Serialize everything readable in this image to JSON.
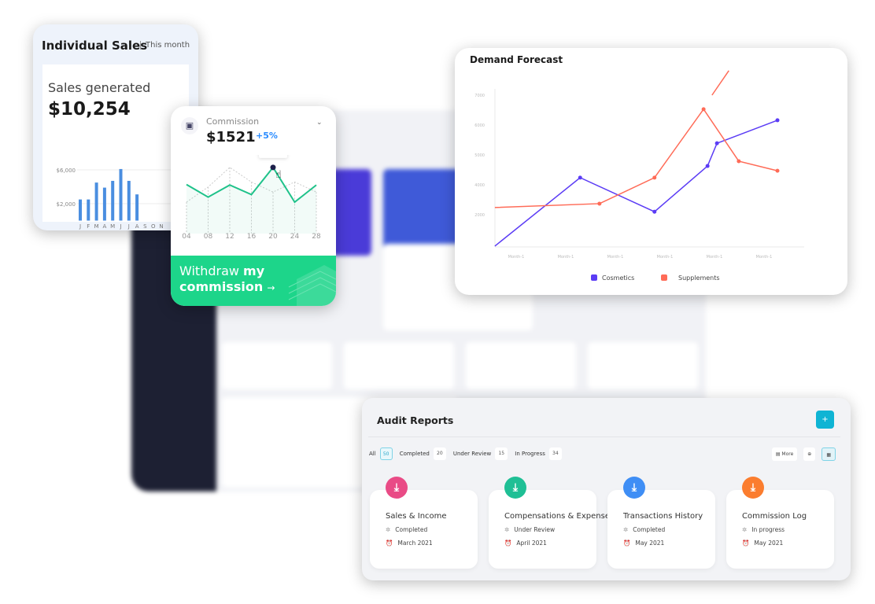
{
  "colors": {
    "cosmetics": "#5b3cf5",
    "supplements": "#ff6b57",
    "bar": "#4a8ee0",
    "commission_line": "#1fc28a",
    "audit_plus": "#0fb4d4"
  },
  "individual_sales": {
    "title": "Individual Sales",
    "period": "This month",
    "label": "Sales generated",
    "value": "$10,254",
    "chart_data": {
      "type": "bar",
      "categories": [
        "J",
        "F",
        "M",
        "A",
        "M",
        "J",
        "J",
        "A",
        "S",
        "O",
        "N"
      ],
      "values": [
        2500,
        2500,
        4500,
        3900,
        4700,
        6100,
        4700,
        3100,
        null,
        null,
        null
      ],
      "ytick_labels": [
        "$6,000",
        "$2,000"
      ],
      "yticks": [
        6000,
        2000
      ],
      "ylim": [
        0,
        7000
      ],
      "grid": true
    }
  },
  "commission": {
    "icon": "money-icon",
    "title": "Commission",
    "value": "$1521",
    "change": "+5%",
    "tooltip": "$ 258",
    "withdraw_regular": "Withdraw ",
    "withdraw_bold_1": "my",
    "withdraw_bold_2": "commission",
    "arrow": "→",
    "chart_data": {
      "type": "line",
      "categories": [
        "04",
        "08",
        "12",
        "16",
        "20",
        "24",
        "28"
      ],
      "values": [
        190,
        140,
        188,
        150,
        258,
        120,
        188
      ],
      "comparison_values": [
        120,
        180,
        258,
        200,
        160,
        200,
        160
      ],
      "highlight_index": 4
    }
  },
  "demand_forecast": {
    "title": "Demand Forecast",
    "chart_data": {
      "type": "line",
      "yticks": [
        3000,
        4000,
        5000,
        6000,
        7000
      ],
      "ytick_labels": [
        "2000",
        "4000",
        "5000",
        "6000",
        "7000"
      ],
      "categories": [
        "Month-1",
        "Month-1",
        "Month-1",
        "Month-1",
        "Month-1",
        "Month-1"
      ],
      "ylim": [
        1950,
        7000
      ],
      "series": [
        {
          "name": "Cosmetics",
          "x": [
            -0.43,
            1.29,
            2.79,
            3.86,
            4.05,
            5.27
          ],
          "y": [
            1950,
            4240,
            3100,
            4630,
            5390,
            6160
          ]
        },
        {
          "name": "Supplements",
          "x": [
            -0.43,
            1.68,
            2.79,
            3.78,
            4.49,
            5.27
          ],
          "y": [
            3240,
            3370,
            4240,
            6530,
            4790,
            4470
          ]
        }
      ],
      "extra_segment": {
        "x": [
          3.95,
          4.29
        ],
        "y": [
          7000,
          7820
        ]
      },
      "legend": "bottom"
    }
  },
  "audit": {
    "title": "Audit Reports",
    "add": "+",
    "filters": [
      {
        "label": "All",
        "count": "50"
      },
      {
        "label": "Completed",
        "count": "20"
      },
      {
        "label": "Under Review",
        "count": "15"
      },
      {
        "label": "In Progress",
        "count": "34"
      }
    ],
    "more": "More",
    "reports": [
      {
        "name": "Sales & Income",
        "status": "Completed",
        "date": "March 2021",
        "color": "#e94b86"
      },
      {
        "name": "Compensations & Expenses",
        "status": "Under Review",
        "date": "April 2021",
        "color": "#1fbf95"
      },
      {
        "name": "Transactions History",
        "status": "Completed",
        "date": "May 2021",
        "color": "#3f8ef5"
      },
      {
        "name": "Commission Log",
        "status": "In progress",
        "date": "May 2021",
        "color": "#fb7d2f"
      }
    ]
  }
}
